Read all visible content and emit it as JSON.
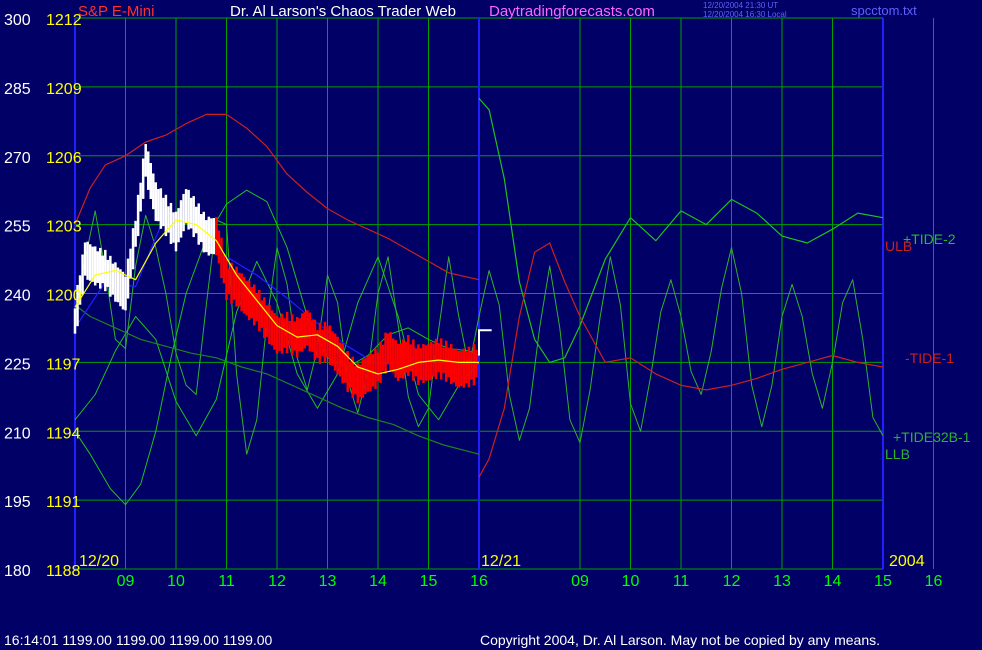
{
  "header": {
    "instrument": "S&P E-Mini",
    "title": "Dr. Al Larson's Chaos Trader Web",
    "site": "Daytradingforecasts.com",
    "timestamp_ut": "12/20/2004 21:30 UT",
    "timestamp_local": "12/20/2004 16:30 Local",
    "file": "spcctom.txt"
  },
  "footer": {
    "quote": "16:14:01  1199.00 1199.00 1199.00 1199.00",
    "copyright": "Copyright 2004, Dr. Al Larson. May not be copied by any means."
  },
  "colors": {
    "background": "#000066",
    "grid": "#00a000",
    "price_white": "#ffffff",
    "price_red": "#ff0000",
    "moving_avg": "#ffff00",
    "blue_line": "#2020ff",
    "llb": "#208020",
    "ulb": "#cc2020",
    "tide2": "#20c020",
    "tide1": "#cc2020",
    "tide32b": "#30b030",
    "axis_yellow": "#ffff00",
    "axis_green": "#00ff00"
  },
  "chart_data": {
    "type": "line",
    "grid": true,
    "x_hour_ticks": [
      "09",
      "10",
      "11",
      "12",
      "13",
      "14",
      "15",
      "16",
      "09",
      "10",
      "11",
      "12",
      "13",
      "14",
      "15",
      "16"
    ],
    "date_labels": [
      "12/20",
      "12/21"
    ],
    "year_label": "2004",
    "y_left_ticks": [
      "300",
      "285",
      "270",
      "255",
      "240",
      "225",
      "210",
      "195",
      "180"
    ],
    "y_price_ticks": [
      "1212",
      "1209",
      "1206",
      "1203",
      "1200",
      "1197",
      "1194",
      "1191",
      "1188"
    ],
    "ylim_price": [
      1188,
      1212
    ],
    "ylim_left": [
      180,
      300
    ],
    "price_bar_color_change_at": 10.8,
    "series_labels": [
      "+TIDE-2",
      "ULB",
      "-TIDE-1",
      "+TIDE32B-1",
      "LLB"
    ],
    "series": {
      "price": {
        "x": [
          8.0,
          8.2,
          8.4,
          8.6,
          8.8,
          9.0,
          9.2,
          9.4,
          9.6,
          9.8,
          10.0,
          10.2,
          10.4,
          10.6,
          10.8,
          11.0,
          11.2,
          11.4,
          11.6,
          11.8,
          12.0,
          12.2,
          12.4,
          12.6,
          12.8,
          13.0,
          13.2,
          13.4,
          13.6,
          13.8,
          14.0,
          14.2,
          14.4,
          14.6,
          14.8,
          15.0,
          15.2,
          15.4,
          15.6,
          15.8,
          16.0
        ],
        "y": [
          1198.8,
          1201.5,
          1201.2,
          1201.0,
          1200.5,
          1200.0,
          1202.6,
          1205.8,
          1204.0,
          1203.4,
          1202.7,
          1203.8,
          1203.2,
          1202.5,
          1202.5,
          1200.6,
          1200.3,
          1199.8,
          1199.4,
          1198.8,
          1198.2,
          1198.3,
          1198.1,
          1198.5,
          1197.8,
          1197.9,
          1197.3,
          1196.6,
          1196.1,
          1196.5,
          1196.8,
          1197.6,
          1197.0,
          1197.3,
          1196.9,
          1197.0,
          1197.2,
          1197.0,
          1196.7,
          1196.8,
          1197.0
        ]
      },
      "forecast": {
        "x": [
          16.0,
          16.25
        ],
        "y": [
          1197.3,
          1198.4
        ]
      },
      "moving_avg": {
        "x": [
          8.0,
          8.4,
          8.8,
          9.2,
          9.6,
          10.0,
          10.4,
          10.8,
          11.2,
          11.6,
          12.0,
          12.4,
          12.8,
          13.2,
          13.6,
          14.0,
          14.4,
          14.8,
          15.2,
          15.6,
          16.0
        ],
        "y": [
          1199.4,
          1200.8,
          1201.0,
          1200.6,
          1202.2,
          1203.2,
          1203.0,
          1202.3,
          1200.8,
          1199.7,
          1198.6,
          1198.1,
          1198.2,
          1197.7,
          1196.8,
          1196.5,
          1196.7,
          1197.0,
          1197.1,
          1197.0,
          1197.0
        ]
      },
      "blue": {
        "x": [
          8.0,
          8.6,
          9.2,
          9.8,
          10.4,
          11.0,
          11.6,
          12.2,
          12.8,
          13.4,
          14.0,
          14.6,
          15.2,
          16.0
        ],
        "y": [
          1198.5,
          1200.5,
          1200.3,
          1203.5,
          1203.0,
          1201.6,
          1200.8,
          1199.8,
          1198.7,
          1197.7,
          1196.9,
          1197.0,
          1197.1,
          1197.2
        ]
      },
      "llb": {
        "x": [
          8.0,
          8.3,
          8.8,
          9.3,
          9.8,
          10.3,
          10.8,
          11.3,
          11.8,
          12.3,
          12.8,
          13.3,
          13.8,
          14.3,
          14.8,
          15.3,
          16.0
        ],
        "y": [
          1199.5,
          1199.0,
          1198.5,
          1198.0,
          1197.7,
          1197.4,
          1197.2,
          1196.8,
          1196.5,
          1196.0,
          1195.5,
          1195.0,
          1194.6,
          1194.3,
          1193.8,
          1193.4,
          1193.0
        ]
      },
      "ulb": {
        "x": [
          8.0,
          8.3,
          8.6,
          9.0,
          9.4,
          9.8,
          10.2,
          10.6,
          11.0,
          11.4,
          11.8,
          12.2,
          12.6,
          13.0,
          13.4,
          13.8,
          14.2,
          14.6,
          15.0,
          15.4,
          15.8,
          16.0
        ],
        "y": [
          1203.0,
          1204.6,
          1205.6,
          1206.0,
          1206.6,
          1206.9,
          1207.4,
          1207.8,
          1207.8,
          1207.2,
          1206.4,
          1205.2,
          1204.4,
          1203.7,
          1203.2,
          1202.8,
          1202.4,
          1201.9,
          1201.4,
          1200.9,
          1200.7,
          1200.6
        ]
      },
      "tide2": {
        "x": [
          16.0,
          16.2,
          16.5,
          16.8,
          17.1,
          17.4,
          17.7,
          18.0,
          18.5,
          19.0,
          19.5,
          20.0,
          20.5,
          21.0,
          21.5,
          22.0,
          22.5,
          23.0,
          23.5,
          24.0
        ],
        "y": [
          1208.5,
          1208.0,
          1205.0,
          1200.5,
          1198.0,
          1197.0,
          1197.2,
          1198.6,
          1201.5,
          1203.3,
          1202.3,
          1203.6,
          1203.0,
          1204.1,
          1203.5,
          1202.5,
          1202.2,
          1202.8,
          1203.5,
          1203.3
        ]
      },
      "tide1": {
        "x": [
          16.0,
          16.2,
          16.5,
          16.8,
          17.1,
          17.4,
          17.7,
          18.0,
          18.5,
          19.0,
          19.5,
          20.0,
          20.5,
          21.0,
          21.5,
          22.0,
          22.5,
          23.0,
          23.5,
          24.0
        ],
        "y": [
          1192.0,
          1192.8,
          1195.0,
          1199.0,
          1201.8,
          1202.2,
          1200.5,
          1199.0,
          1197.0,
          1197.2,
          1196.5,
          1196.0,
          1195.8,
          1196.0,
          1196.3,
          1196.7,
          1197.0,
          1197.3,
          1197.0,
          1196.8
        ]
      },
      "tide32b": {
        "x": [
          8.0,
          8.2,
          8.4,
          8.6,
          8.8,
          9.0,
          9.2,
          9.4,
          9.6,
          9.8,
          10.0,
          10.2,
          10.4,
          10.6,
          10.8,
          11.0,
          11.2,
          11.4,
          11.6,
          11.8,
          12.0,
          12.2,
          12.4,
          12.6,
          12.8,
          13.0,
          13.2,
          13.4,
          13.6,
          13.8,
          14.0,
          14.2,
          14.4,
          14.6,
          14.8,
          15.0,
          15.2,
          15.4,
          15.6,
          15.8,
          16.0,
          16.2,
          16.4,
          16.6,
          16.8,
          17.0,
          17.2,
          17.4,
          17.6,
          17.8,
          18.0,
          18.2,
          18.4,
          18.6,
          18.8,
          19.0,
          19.2,
          19.4,
          19.6,
          19.8,
          20.0,
          20.2,
          20.4,
          20.6,
          20.8,
          21.0,
          21.2,
          21.4,
          21.6,
          21.8,
          22.0,
          22.2,
          22.4,
          22.6,
          22.8,
          23.0,
          23.2,
          23.4,
          23.6,
          23.8,
          24.0
        ],
        "y": [
          1199.0,
          1201.5,
          1203.6,
          1201.0,
          1198.0,
          1197.6,
          1201.2,
          1203.4,
          1202.0,
          1200.0,
          1197.4,
          1196.0,
          1195.6,
          1199.5,
          1203.2,
          1203.0,
          1196.5,
          1193.0,
          1194.5,
          1198.8,
          1202.0,
          1200.4,
          1197.2,
          1195.8,
          1197.6,
          1200.8,
          1199.6,
          1196.2,
          1194.8,
          1196.6,
          1200.0,
          1201.6,
          1198.6,
          1195.5,
          1194.2,
          1195.0,
          1198.4,
          1201.6,
          1199.0,
          1196.8,
          1199.0,
          1201.0,
          1199.5,
          1195.6,
          1193.6,
          1195.0,
          1198.5,
          1201.2,
          1198.5,
          1194.5,
          1193.5,
          1195.8,
          1199.0,
          1201.6,
          1199.5,
          1195.2,
          1194.0,
          1196.4,
          1199.2,
          1200.6,
          1199.0,
          1196.6,
          1195.6,
          1197.5,
          1200.2,
          1202.0,
          1200.0,
          1196.0,
          1194.2,
          1196.0,
          1199.0,
          1200.4,
          1199.0,
          1196.5,
          1195.0,
          1197.0,
          1199.6,
          1200.6,
          1198.0,
          1194.6,
          1193.8
        ]
      },
      "tide32b_a": {
        "x": [
          8.0,
          8.4,
          8.8,
          9.2,
          9.6,
          10.0,
          10.4,
          10.8,
          11.2,
          11.6,
          12.0,
          12.4,
          12.8,
          13.2,
          13.6,
          14.0,
          14.4,
          14.8,
          15.2,
          15.6,
          16.0
        ],
        "y": [
          1194.5,
          1195.6,
          1197.5,
          1199.0,
          1198.0,
          1195.3,
          1193.8,
          1195.4,
          1199.2,
          1201.4,
          1199.6,
          1196.5,
          1195.0,
          1196.5,
          1199.6,
          1201.6,
          1199.0,
          1195.6,
          1194.5,
          1196.0,
          1197.0
        ]
      },
      "tide32b_b": {
        "x": [
          8.0,
          8.3,
          8.7,
          9.0,
          9.3,
          9.6,
          9.9,
          10.2,
          10.6,
          11.0,
          11.4,
          11.8,
          12.2,
          12.6,
          13.0,
          13.4,
          13.8,
          14.2,
          14.6,
          15.0,
          15.4,
          15.8,
          16.0
        ],
        "y": [
          1194.0,
          1193.0,
          1191.5,
          1190.8,
          1191.7,
          1194.0,
          1197.2,
          1200.0,
          1202.4,
          1203.9,
          1204.5,
          1204.0,
          1202.0,
          1199.0,
          1197.2,
          1196.8,
          1197.3,
          1198.2,
          1198.5,
          1198.0,
          1197.6,
          1197.5,
          1197.3
        ]
      }
    }
  }
}
